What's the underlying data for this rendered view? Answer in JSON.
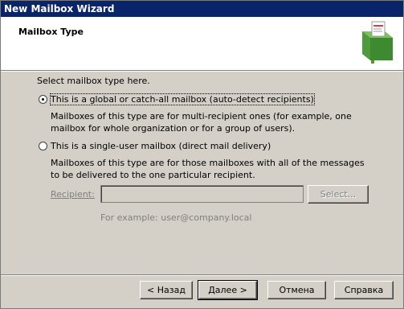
{
  "window": {
    "title": "New Mailbox Wizard"
  },
  "header": {
    "title": "Mailbox Type",
    "icon": "mailbox-icon"
  },
  "main": {
    "prompt": "Select mailbox type here.",
    "options": [
      {
        "label": "This is a global or catch-all mailbox (auto-detect recipients)",
        "description": "Mailboxes of this type are for multi-recipient ones (for example, one mailbox for whole organization or for a group of users).",
        "checked": true
      },
      {
        "label": "This is a single-user mailbox (direct mail delivery)",
        "description": "Mailboxes of this type are for those mailboxes with all of the messages to be delivered to the one particular recipient.",
        "checked": false
      }
    ],
    "recipient": {
      "label": "Recipient:",
      "value": "",
      "select_label": "Select...",
      "example": "For example: user@company.local"
    }
  },
  "buttons": {
    "back": "< Назад",
    "next": "Далее >",
    "cancel": "Отмена",
    "help": "Справка"
  }
}
